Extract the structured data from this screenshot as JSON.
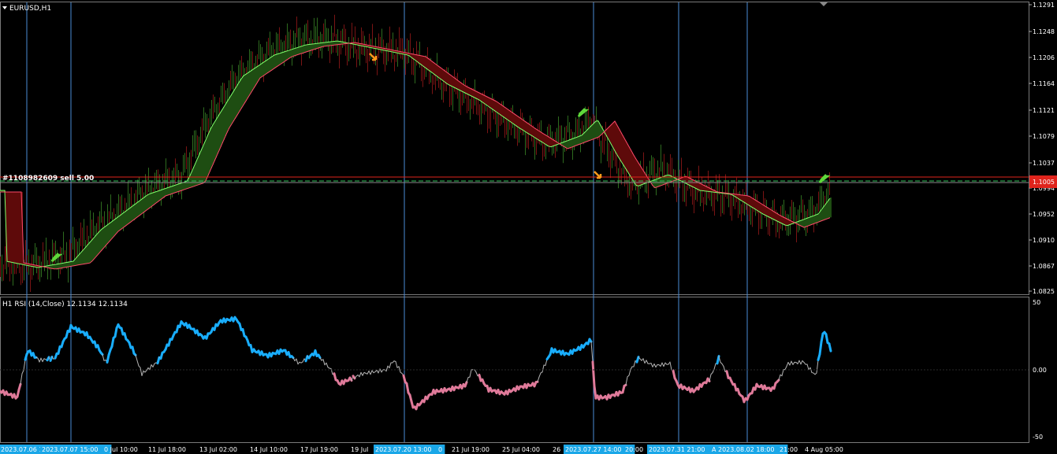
{
  "symbol_title": "EURUSD,H1",
  "indicator_title": "H1 RSI (14,Close) 12.1134 12.1134",
  "order_label": "#1108982609 sell 5.00",
  "current_price": "1.1005",
  "price_axis_labels": [
    "1.1291",
    "1.1248",
    "1.1206",
    "1.1164",
    "1.1121",
    "1.1079",
    "1.1037",
    "1.0994",
    "1.0952",
    "1.0910",
    "1.0867",
    "1.0825"
  ],
  "rsi_axis_labels": [
    "50",
    "0.00",
    "-50"
  ],
  "time_labels": [
    "2023.07.06 1",
    "2023.07.07 15:00",
    "0 Jul 10:00",
    "11 Jul 18:00",
    "13 Jul 02:00",
    "14 Jul 10:00",
    "17 Jul 19:00",
    "19 Jul",
    "2023.07.20 13:00",
    "0",
    "21 Jul 19:00",
    "25 Jul 04:00",
    "26",
    "2023.07.27 14:00",
    "20:00",
    "2023.07.31 21:00",
    "A",
    "2023.08.02 18:00",
    "21:00",
    "4 Aug 05:00"
  ],
  "highlighted_time_labels": [
    "2023.07.06 1",
    "2023.07.07 15:00",
    "2023.07.20 13:00",
    "2023.07.27 14:00",
    "2023.07.31 21:00",
    "2023.08.02 18:00"
  ],
  "colors": {
    "background": "#000000",
    "bull_candle": "#2e6b1f",
    "bear_candle": "#7a1414",
    "up_band": "#1e4d12",
    "up_line": "#7fff6a",
    "down_band": "#5e0a0a",
    "down_line": "#ff4a6a",
    "rsi_high": "#19aeff",
    "rsi_mid": "#b4b4b4",
    "rsi_low": "#e07a9a",
    "vline": "#4a8bd6",
    "order_line": "#e0241c",
    "bid_line": "#2fc25a",
    "price_box": "#e0241c",
    "time_highlight": "#1aa7e8"
  },
  "icons": [
    "triangle-down-icon",
    "green-up-arrow-icon",
    "orange-down-arrow-icon"
  ]
}
